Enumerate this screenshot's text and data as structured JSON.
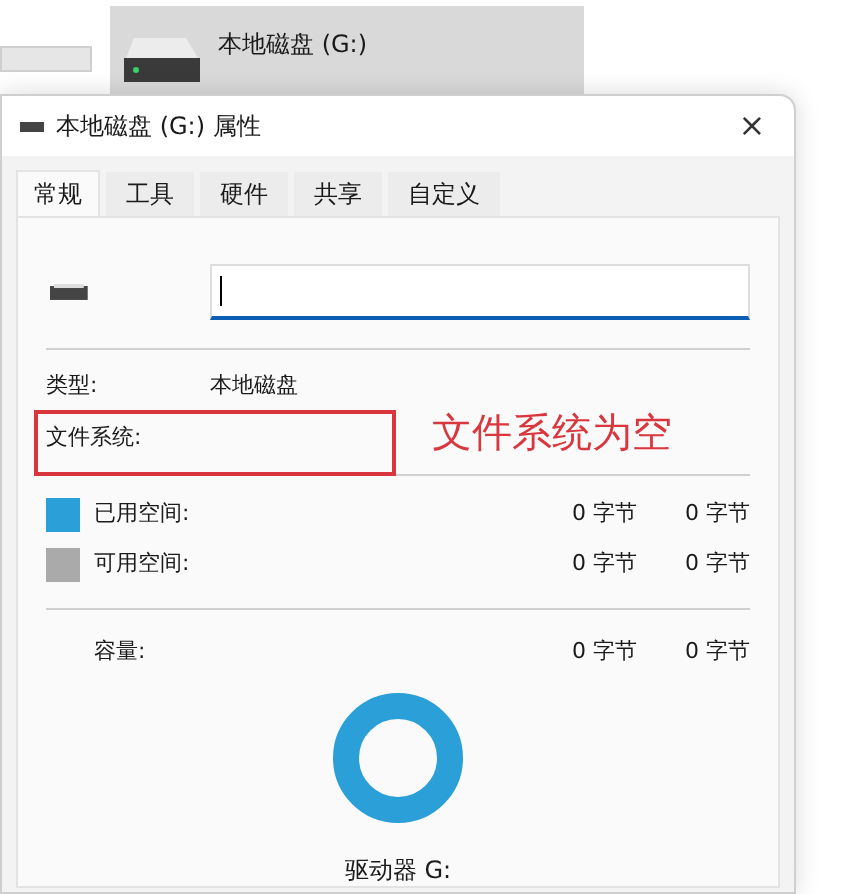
{
  "background": {
    "drive_tile": {
      "label": "本地磁盘 (G:)"
    }
  },
  "window": {
    "title": "本地磁盘 (G:) 属性",
    "close": "×"
  },
  "tabs": [
    {
      "label": "常规",
      "selected": true
    },
    {
      "label": "工具",
      "selected": false
    },
    {
      "label": "硬件",
      "selected": false
    },
    {
      "label": "共享",
      "selected": false
    },
    {
      "label": "自定义",
      "selected": false
    }
  ],
  "properties": [
    {
      "label": "类型:",
      "value": "本地磁盘"
    },
    {
      "label": "文件系统:"
    }
  ],
  "space": [
    {
      "label": "已用空间:",
      "color": "#2a9fd8",
      "bytes": "0 字节",
      "size": "0 字节"
    },
    {
      "label": "可用空间:",
      "color": "#aaaaaa",
      "bytes": "0 字节",
      "size": "0 字节"
    }
  ],
  "capacity": {
    "label": "容量:",
    "bytes": "0 字节",
    "size": "0 字节"
  },
  "drive_label": "驱动器 G:",
  "annotation": {
    "text": "文件系统为空"
  }
}
